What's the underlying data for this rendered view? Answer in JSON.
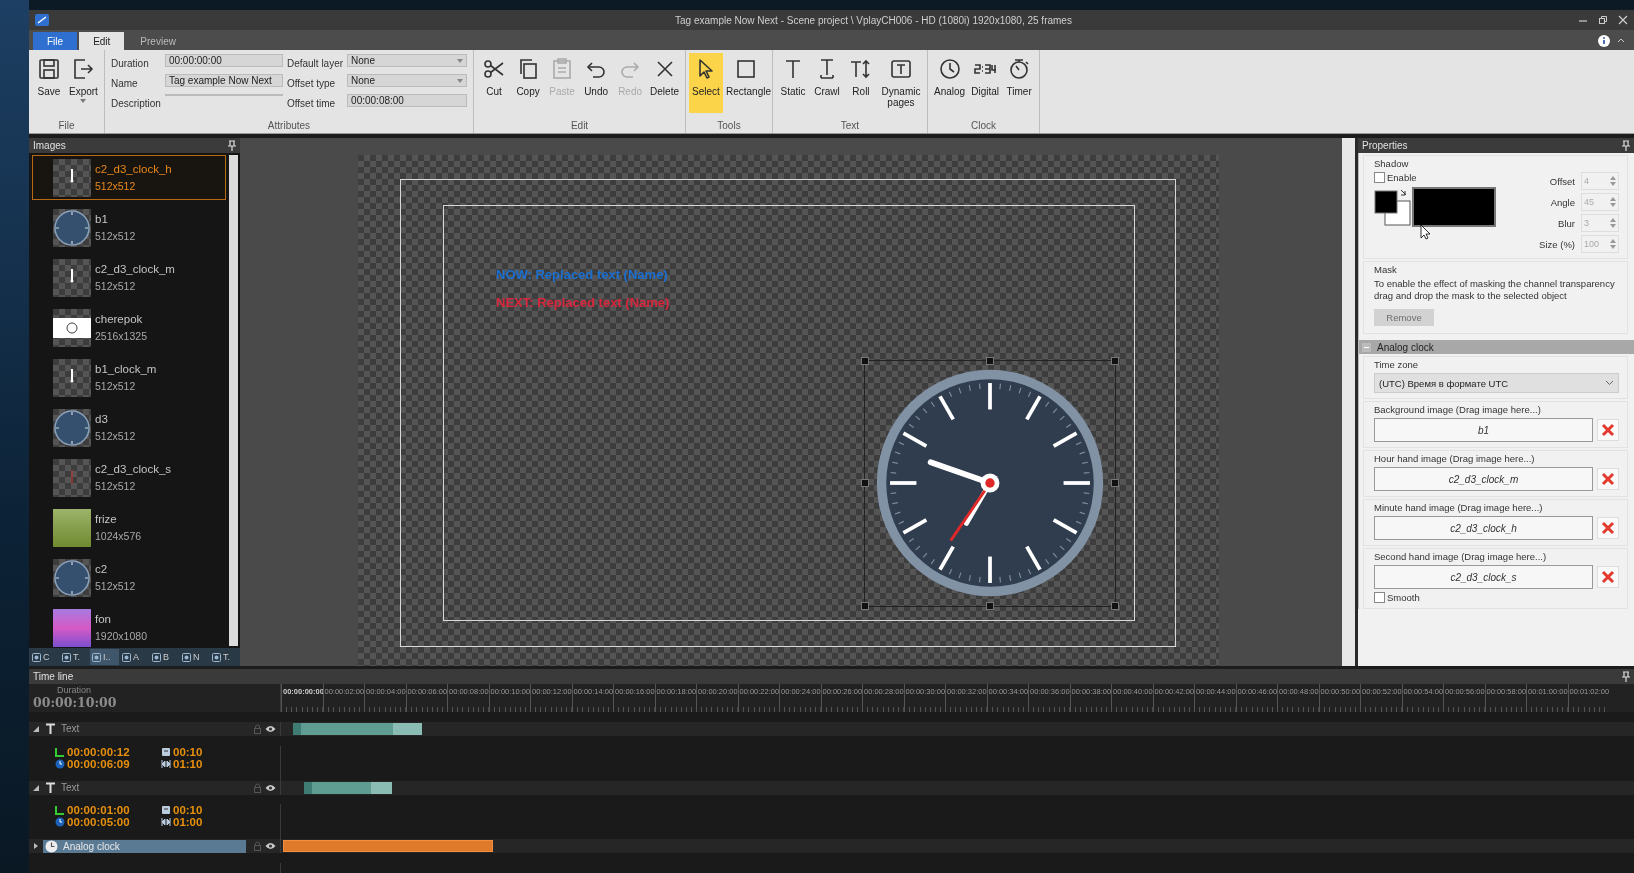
{
  "window": {
    "title": "Tag example Now Next -  Scene project \\ VplayCH006 - HD (1080i) 1920x1080, 25 frames"
  },
  "ribbon_tabs": [
    {
      "label": "File",
      "kind": "menu",
      "selected": false
    },
    {
      "label": "Edit",
      "kind": "tab",
      "selected": true
    },
    {
      "label": "Preview",
      "kind": "tab",
      "selected": false
    }
  ],
  "ribbon": {
    "groups": [
      {
        "label": "File",
        "kind": "buttons",
        "buttons": [
          {
            "label": "Save",
            "disabled": false,
            "selected": false
          },
          {
            "label": "Export",
            "disabled": false,
            "selected": false
          }
        ]
      },
      {
        "label": "Attributes",
        "kind": "fields",
        "fields": [
          {
            "label": "Duration",
            "value": "00:00:00:00",
            "kind": "text"
          },
          {
            "label": "Name",
            "value": "Tag example Now Next",
            "kind": "text"
          },
          {
            "label": "Description",
            "kind": "text"
          },
          {
            "label": "Default layer",
            "value": "None",
            "kind": "dropdown"
          },
          {
            "label": "Offset type",
            "value": "None",
            "kind": "dropdown"
          },
          {
            "label": "Offset time",
            "value": "00:00:08:00",
            "kind": "text"
          }
        ]
      },
      {
        "label": "Edit",
        "kind": "buttons",
        "buttons": [
          {
            "label": "Cut",
            "disabled": false,
            "selected": false
          },
          {
            "label": "Copy",
            "disabled": false,
            "selected": false
          },
          {
            "label": "Paste",
            "disabled": true,
            "selected": false
          },
          {
            "label": "Undo",
            "disabled": false,
            "selected": false
          },
          {
            "label": "Redo",
            "disabled": true,
            "selected": false
          },
          {
            "label": "Delete",
            "disabled": false,
            "selected": false
          }
        ]
      },
      {
        "label": "Tools",
        "kind": "buttons",
        "buttons": [
          {
            "label": "Select",
            "disabled": false,
            "selected": true
          },
          {
            "label": "Rectangle",
            "disabled": false,
            "selected": false
          }
        ]
      },
      {
        "label": "Text",
        "kind": "buttons",
        "buttons": [
          {
            "label": "Static",
            "disabled": false,
            "selected": false
          },
          {
            "label": "Crawl",
            "disabled": false,
            "selected": false
          },
          {
            "label": "Roll",
            "disabled": false,
            "selected": false
          },
          {
            "label": "Dynamic pages",
            "disabled": false,
            "selected": false
          }
        ]
      },
      {
        "label": "Clock",
        "kind": "buttons",
        "buttons": [
          {
            "label": "Analog",
            "disabled": false,
            "selected": false
          },
          {
            "label": "Digital",
            "disabled": false,
            "selected": false
          },
          {
            "label": "Timer",
            "disabled": false,
            "selected": false
          }
        ]
      }
    ]
  },
  "images_panel": {
    "title": "Images",
    "items": [
      {
        "name": "c2_d3_clock_h",
        "size": "512x512",
        "selected": true
      },
      {
        "name": "b1",
        "size": "512x512",
        "selected": false
      },
      {
        "name": "c2_d3_clock_m",
        "size": "512x512",
        "selected": false
      },
      {
        "name": "cherepok",
        "size": "2516x1325",
        "selected": false
      },
      {
        "name": "b1_clock_m",
        "size": "512x512",
        "selected": false
      },
      {
        "name": "d3",
        "size": "512x512",
        "selected": false
      },
      {
        "name": "c2_d3_clock_s",
        "size": "512x512",
        "selected": false
      },
      {
        "name": "frize",
        "size": "1024x576",
        "selected": false
      },
      {
        "name": "c2",
        "size": "512x512",
        "selected": false
      },
      {
        "name": "fon",
        "size": "1920x1080",
        "selected": false
      }
    ],
    "tabs": [
      {
        "label": "C",
        "selected": false
      },
      {
        "label": "T.",
        "selected": false
      },
      {
        "label": "I..",
        "selected": true
      },
      {
        "label": "A",
        "selected": false
      },
      {
        "label": "B",
        "selected": false
      },
      {
        "label": "N",
        "selected": false
      },
      {
        "label": "T.",
        "selected": false
      }
    ]
  },
  "canvas": {
    "texts": [
      {
        "text": "NOW: Replaced text (Name)",
        "color": "#1a6fd0"
      },
      {
        "text": "NEXT: Replaced text (Name)",
        "color": "#d8263c"
      }
    ]
  },
  "properties": {
    "title": "Properties",
    "shadow": {
      "title": "Shadow",
      "enable": {
        "label": "Enable",
        "checked": false
      },
      "spinners": [
        {
          "label": "Offset",
          "value": "4"
        },
        {
          "label": "Angle",
          "value": "45"
        },
        {
          "label": "Blur",
          "value": "3"
        },
        {
          "label": "Size (%)",
          "value": "100"
        }
      ]
    },
    "mask": {
      "title": "Mask",
      "text": "To enable the effect of masking the channel transparency drag and drop the mask to the selected object",
      "button": {
        "label": "Remove",
        "disabled": true
      }
    },
    "analog_clock": {
      "title": "Analog clock",
      "expanded": true,
      "time_zone_label": "Time zone",
      "time_zone": "(UTC) Время в формате UTC",
      "images": [
        {
          "label": "Background image (Drag image here...)",
          "value": "b1"
        },
        {
          "label": "Hour hand image (Drag image here...)",
          "value": "c2_d3_clock_m"
        },
        {
          "label": "Minute hand image (Drag image here...)",
          "value": "c2_d3_clock_h"
        },
        {
          "label": "Second hand image (Drag image here...)",
          "value": "c2_d3_clock_s"
        }
      ],
      "smooth": {
        "label": "Smooth",
        "checked": false
      }
    }
  },
  "timeline": {
    "title": "Time line",
    "duration_label": "Duration",
    "duration": "00:00:10:00",
    "ruler": [
      "00:00:00:00",
      "00:00:02:00",
      "00:00:04:00",
      "00:00:06:00",
      "00:00:08:00",
      "00:00:10:00",
      "00:00:12:00",
      "00:00:14:00",
      "00:00:16:00",
      "00:00:18:00",
      "00:00:20:00",
      "00:00:22:00",
      "00:00:24:00",
      "00:00:26:00",
      "00:00:28:00",
      "00:00:30:00",
      "00:00:32:00",
      "00:00:34:00",
      "00:00:36:00",
      "00:00:38:00",
      "00:00:40:00",
      "00:00:42:00",
      "00:00:44:00",
      "00:00:46:00",
      "00:00:48:00",
      "00:00:50:00",
      "00:00:52:00",
      "00:00:54:00",
      "00:00:56:00",
      "00:00:58:00",
      "00:01:00:00",
      "00:01:02:00"
    ],
    "tracks": [
      {
        "label": "Text",
        "kind": "text",
        "expanded": true,
        "selected": false,
        "start": "00:00:00:12",
        "end": "00:00:06:09",
        "fade_in": "00:10",
        "fade_out": "01:10"
      },
      {
        "label": "Text",
        "kind": "text",
        "expanded": true,
        "selected": false,
        "start": "00:00:01:00",
        "end": "00:00:05:00",
        "fade_in": "00:10",
        "fade_out": "01:00"
      },
      {
        "label": "Analog clock",
        "kind": "clock",
        "expanded": false,
        "selected": true
      }
    ]
  }
}
